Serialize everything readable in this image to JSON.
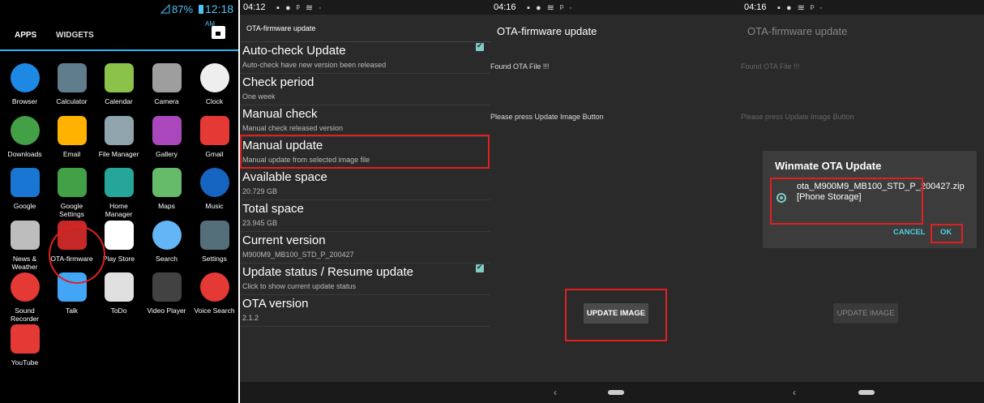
{
  "launcher": {
    "status": {
      "battery": "87%",
      "time": "12:18",
      "ampm": "AM"
    },
    "tabs": {
      "apps": "APPS",
      "widgets": "WIDGETS"
    },
    "apps": [
      {
        "label": "Browser",
        "icon": "globe-icon",
        "color": "#1e88e5"
      },
      {
        "label": "Calculator",
        "icon": "calculator-icon",
        "color": "#607d8b"
      },
      {
        "label": "Calendar",
        "icon": "calendar-icon",
        "color": "#8bc34a"
      },
      {
        "label": "Camera",
        "icon": "camera-icon",
        "color": "#9e9e9e"
      },
      {
        "label": "Clock",
        "icon": "clock-icon",
        "color": "#eeeeee"
      },
      {
        "label": "Downloads",
        "icon": "download-icon",
        "color": "#43a047"
      },
      {
        "label": "Email",
        "icon": "email-icon",
        "color": "#ffb300"
      },
      {
        "label": "File Manager",
        "icon": "folder-icon",
        "color": "#90a4ae"
      },
      {
        "label": "Gallery",
        "icon": "gallery-icon",
        "color": "#ab47bc"
      },
      {
        "label": "Gmail",
        "icon": "gmail-icon",
        "color": "#e53935"
      },
      {
        "label": "Google",
        "icon": "google-icon",
        "color": "#1976d2"
      },
      {
        "label": "Google Settings",
        "icon": "google-settings-icon",
        "color": "#43a047"
      },
      {
        "label": "Home Manager",
        "icon": "tools-icon",
        "color": "#26a69a"
      },
      {
        "label": "Maps",
        "icon": "maps-icon",
        "color": "#66bb6a"
      },
      {
        "label": "Music",
        "icon": "music-icon",
        "color": "#1565c0"
      },
      {
        "label": "News & Weather",
        "icon": "news-icon",
        "color": "#bdbdbd"
      },
      {
        "label": "OTA-firmware",
        "icon": "ota-icon",
        "color": "#c62828"
      },
      {
        "label": "Play Store",
        "icon": "play-store-icon",
        "color": "#ffffff"
      },
      {
        "label": "Search",
        "icon": "search-icon",
        "color": "#64b5f6"
      },
      {
        "label": "Settings",
        "icon": "settings-icon",
        "color": "#546e7a"
      },
      {
        "label": "Sound Recorder",
        "icon": "microphone-icon",
        "color": "#e53935"
      },
      {
        "label": "Talk",
        "icon": "talk-icon",
        "color": "#42a5f5"
      },
      {
        "label": "ToDo",
        "icon": "todo-icon",
        "color": "#e0e0e0"
      },
      {
        "label": "Video Player",
        "icon": "video-icon",
        "color": "#424242"
      },
      {
        "label": "Voice Search",
        "icon": "microphone-icon",
        "color": "#e53935"
      },
      {
        "label": "YouTube",
        "icon": "youtube-icon",
        "color": "#e53935"
      }
    ]
  },
  "settings": {
    "status": {
      "time": "04:12"
    },
    "title": "OTA-firmware update",
    "items": [
      {
        "title": "Auto-check Update",
        "subtitle": "Auto-check have new version been released",
        "checkbox": true
      },
      {
        "title": "Check period",
        "subtitle": "One week"
      },
      {
        "title": "Manual check",
        "subtitle": "Manual check released version"
      },
      {
        "title": "Manual update",
        "subtitle": "Manual update from selected image file"
      },
      {
        "title": "Available space",
        "subtitle": "20.729 GB"
      },
      {
        "title": "Total space",
        "subtitle": "23.945 GB"
      },
      {
        "title": "Current version",
        "subtitle": "M900M9_MB100_STD_P_200427"
      },
      {
        "title": "Update status / Resume update",
        "subtitle": "Click to show current update status",
        "checkbox": true
      },
      {
        "title": "OTA version",
        "subtitle": "2.1.2"
      }
    ]
  },
  "update": {
    "status": {
      "time": "04:16"
    },
    "title": "OTA-firmware update",
    "found": "Found OTA File !!!",
    "instruction": "Please press Update Image Button",
    "button": "UPDATE IMAGE"
  },
  "dialog_screen": {
    "status": {
      "time": "04:16"
    },
    "title": "OTA-firmware update",
    "found": "Found OTA File !!!",
    "instruction": "Please press Update Image Button",
    "button": "UPDATE IMAGE",
    "dialog": {
      "title": "Winmate OTA Update",
      "option": "ota_M900M9_MB100_STD_P_200427.zip [Phone Storage]",
      "cancel": "CANCEL",
      "ok": "OK"
    }
  }
}
